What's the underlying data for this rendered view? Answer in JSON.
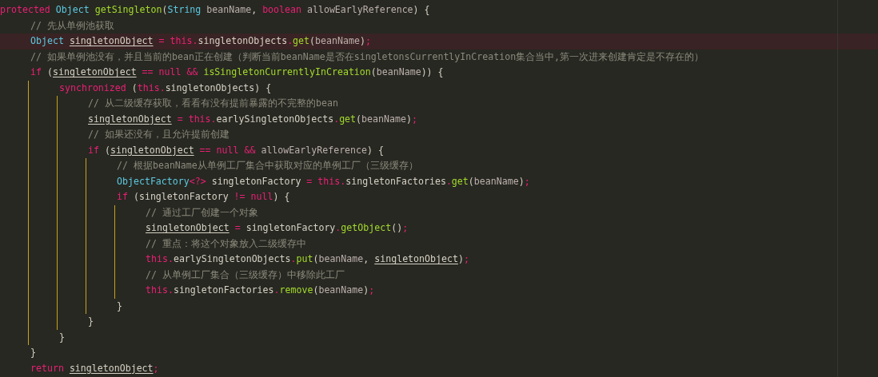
{
  "editor": {
    "lines": [
      {
        "highlighted": false,
        "tokens": [
          {
            "text": "protected ",
            "kind": "keyword"
          },
          {
            "text": "Object ",
            "kind": "type"
          },
          {
            "text": "getSingleton",
            "kind": "method"
          },
          {
            "text": "(",
            "kind": "plain"
          },
          {
            "text": "String ",
            "kind": "type"
          },
          {
            "text": "beanName",
            "kind": "param"
          },
          {
            "text": ", ",
            "kind": "plain"
          },
          {
            "text": "boolean ",
            "kind": "keyword"
          },
          {
            "text": "allowEarlyReference",
            "kind": "param"
          },
          {
            "text": ") {",
            "kind": "plain"
          }
        ],
        "children": [
          {
            "highlighted": false,
            "tokens": [
              {
                "text": "// 先从单例池获取",
                "kind": "comment"
              }
            ]
          },
          {
            "highlighted": true,
            "tokens": [
              {
                "text": "Object ",
                "kind": "type"
              },
              {
                "text": "singletonObject",
                "kind": "reassigned"
              },
              {
                "text": " = ",
                "kind": "operator"
              },
              {
                "text": "this.",
                "kind": "keyword"
              },
              {
                "text": "singletonObjects",
                "kind": "plain"
              },
              {
                "text": ".",
                "kind": "operator"
              },
              {
                "text": "get",
                "kind": "method"
              },
              {
                "text": "(",
                "kind": "plain"
              },
              {
                "text": "beanName",
                "kind": "param"
              },
              {
                "text": ")",
                "kind": "plain"
              },
              {
                "text": ";",
                "kind": "operator"
              }
            ]
          },
          {
            "highlighted": false,
            "tokens": [
              {
                "text": "// 如果单例池没有，并且当前的bean正在创建（判断当前beanName是否在singletonsCurrentlyInCreation集合当中,第一次进来创建肯定是不存在的）",
                "kind": "comment"
              }
            ]
          },
          {
            "highlighted": false,
            "tokens": [
              {
                "text": "if",
                "kind": "keyword"
              },
              {
                "text": " (",
                "kind": "plain"
              },
              {
                "text": "singletonObject",
                "kind": "reassigned"
              },
              {
                "text": " == null && ",
                "kind": "operator"
              },
              {
                "text": "isSingletonCurrentlyInCreation",
                "kind": "method"
              },
              {
                "text": "(",
                "kind": "plain"
              },
              {
                "text": "beanName",
                "kind": "param"
              },
              {
                "text": ")) {",
                "kind": "plain"
              }
            ],
            "children": [
              {
                "highlighted": false,
                "tokens": [
                  {
                    "text": "synchronized",
                    "kind": "keyword"
                  },
                  {
                    "text": " (",
                    "kind": "plain"
                  },
                  {
                    "text": "this.",
                    "kind": "keyword"
                  },
                  {
                    "text": "singletonObjects) {",
                    "kind": "plain"
                  }
                ],
                "children": [
                  {
                    "highlighted": false,
                    "tokens": [
                      {
                        "text": "// 从二级缓存获取，看看有没有提前暴露的不完整的bean",
                        "kind": "comment"
                      }
                    ]
                  },
                  {
                    "highlighted": false,
                    "tokens": [
                      {
                        "text": "singletonObject",
                        "kind": "reassigned"
                      },
                      {
                        "text": " = ",
                        "kind": "operator"
                      },
                      {
                        "text": "this.",
                        "kind": "keyword"
                      },
                      {
                        "text": "earlySingletonObjects",
                        "kind": "plain"
                      },
                      {
                        "text": ".",
                        "kind": "operator"
                      },
                      {
                        "text": "get",
                        "kind": "method"
                      },
                      {
                        "text": "(",
                        "kind": "plain"
                      },
                      {
                        "text": "beanName",
                        "kind": "param"
                      },
                      {
                        "text": ")",
                        "kind": "plain"
                      },
                      {
                        "text": ";",
                        "kind": "operator"
                      }
                    ]
                  },
                  {
                    "highlighted": false,
                    "tokens": [
                      {
                        "text": "// 如果还没有，且允许提前创建",
                        "kind": "comment"
                      }
                    ]
                  },
                  {
                    "highlighted": false,
                    "tokens": [
                      {
                        "text": "if",
                        "kind": "keyword"
                      },
                      {
                        "text": " (",
                        "kind": "plain"
                      },
                      {
                        "text": "singletonObject",
                        "kind": "reassigned"
                      },
                      {
                        "text": " == null && ",
                        "kind": "operator"
                      },
                      {
                        "text": "allowEarlyReference",
                        "kind": "param"
                      },
                      {
                        "text": ") {",
                        "kind": "plain"
                      }
                    ],
                    "children": [
                      {
                        "highlighted": false,
                        "tokens": [
                          {
                            "text": "// 根据beanName从单例工厂集合中获取对应的单例工厂（三级缓存）",
                            "kind": "comment"
                          }
                        ]
                      },
                      {
                        "highlighted": false,
                        "tokens": [
                          {
                            "text": "ObjectFactory",
                            "kind": "type"
                          },
                          {
                            "text": "<?>",
                            "kind": "operator"
                          },
                          {
                            "text": " singletonFactory",
                            "kind": "plain"
                          },
                          {
                            "text": " = ",
                            "kind": "operator"
                          },
                          {
                            "text": "this.",
                            "kind": "keyword"
                          },
                          {
                            "text": "singletonFactories",
                            "kind": "plain"
                          },
                          {
                            "text": ".",
                            "kind": "operator"
                          },
                          {
                            "text": "get",
                            "kind": "method"
                          },
                          {
                            "text": "(",
                            "kind": "plain"
                          },
                          {
                            "text": "beanName",
                            "kind": "param"
                          },
                          {
                            "text": ")",
                            "kind": "plain"
                          },
                          {
                            "text": ";",
                            "kind": "operator"
                          }
                        ]
                      },
                      {
                        "highlighted": false,
                        "tokens": [
                          {
                            "text": "if",
                            "kind": "keyword"
                          },
                          {
                            "text": " (singletonFactory ",
                            "kind": "plain"
                          },
                          {
                            "text": "!= null",
                            "kind": "operator"
                          },
                          {
                            "text": ") {",
                            "kind": "plain"
                          }
                        ],
                        "children": [
                          {
                            "highlighted": false,
                            "tokens": [
                              {
                                "text": "// 通过工厂创建一个对象",
                                "kind": "comment"
                              }
                            ]
                          },
                          {
                            "highlighted": false,
                            "tokens": [
                              {
                                "text": "singletonObject",
                                "kind": "reassigned"
                              },
                              {
                                "text": " = ",
                                "kind": "operator"
                              },
                              {
                                "text": "singletonFactory",
                                "kind": "plain"
                              },
                              {
                                "text": ".",
                                "kind": "operator"
                              },
                              {
                                "text": "getObject",
                                "kind": "method"
                              },
                              {
                                "text": "()",
                                "kind": "plain"
                              },
                              {
                                "text": ";",
                                "kind": "operator"
                              }
                            ]
                          },
                          {
                            "highlighted": false,
                            "tokens": [
                              {
                                "text": "// 重点：将这个对象放入二级缓存中",
                                "kind": "comment"
                              }
                            ]
                          },
                          {
                            "highlighted": false,
                            "tokens": [
                              {
                                "text": "this.",
                                "kind": "keyword"
                              },
                              {
                                "text": "earlySingletonObjects",
                                "kind": "plain"
                              },
                              {
                                "text": ".",
                                "kind": "operator"
                              },
                              {
                                "text": "put",
                                "kind": "method"
                              },
                              {
                                "text": "(",
                                "kind": "plain"
                              },
                              {
                                "text": "beanName",
                                "kind": "param"
                              },
                              {
                                "text": ", ",
                                "kind": "plain"
                              },
                              {
                                "text": "singletonObject",
                                "kind": "reassigned"
                              },
                              {
                                "text": ")",
                                "kind": "plain"
                              },
                              {
                                "text": ";",
                                "kind": "operator"
                              }
                            ]
                          },
                          {
                            "highlighted": false,
                            "tokens": [
                              {
                                "text": "// 从单例工厂集合（三级缓存）中移除此工厂",
                                "kind": "comment"
                              }
                            ]
                          },
                          {
                            "highlighted": false,
                            "tokens": [
                              {
                                "text": "this.",
                                "kind": "keyword"
                              },
                              {
                                "text": "singletonFactories",
                                "kind": "plain"
                              },
                              {
                                "text": ".",
                                "kind": "operator"
                              },
                              {
                                "text": "remove",
                                "kind": "method"
                              },
                              {
                                "text": "(",
                                "kind": "plain"
                              },
                              {
                                "text": "beanName",
                                "kind": "param"
                              },
                              {
                                "text": ")",
                                "kind": "plain"
                              },
                              {
                                "text": ";",
                                "kind": "operator"
                              }
                            ]
                          }
                        ]
                      },
                      {
                        "highlighted": false,
                        "tokens": [
                          {
                            "text": "}",
                            "kind": "plain"
                          }
                        ]
                      }
                    ]
                  },
                  {
                    "highlighted": false,
                    "tokens": [
                      {
                        "text": "}",
                        "kind": "plain"
                      }
                    ]
                  }
                ]
              },
              {
                "highlighted": false,
                "tokens": [
                  {
                    "text": "}",
                    "kind": "plain"
                  }
                ]
              }
            ]
          },
          {
            "highlighted": false,
            "tokens": [
              {
                "text": "}",
                "kind": "plain"
              }
            ]
          },
          {
            "highlighted": false,
            "tokens": [
              {
                "text": "return ",
                "kind": "keyword"
              },
              {
                "text": "singletonObject",
                "kind": "reassigned"
              },
              {
                "text": ";",
                "kind": "operator"
              }
            ]
          }
        ]
      }
    ]
  }
}
